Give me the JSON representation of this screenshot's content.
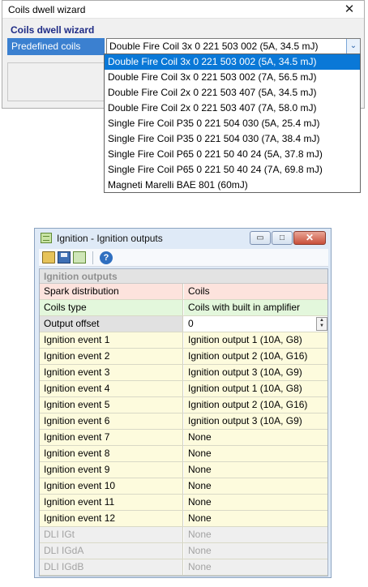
{
  "wizard": {
    "title": "Coils dwell wizard",
    "close_glyph": "✕",
    "section": "Coils dwell wizard",
    "field_label": "Predefined coils",
    "selected_value": "Double Fire Coil 3x 0 221 503 002  (5A, 34.5 mJ)",
    "dropdown_glyph": "⌄",
    "options": [
      "Double Fire Coil 3x 0 221 503 002  (5A, 34.5 mJ)",
      "Double Fire Coil 3x 0 221 503 002  (7A, 56.5 mJ)",
      "Double Fire Coil 2x 0 221 503 407  (5A, 34.5 mJ)",
      "Double Fire Coil 2x 0 221 503 407  (7A, 58.0 mJ)",
      "Single Fire Coil P35  0 221 504 030  (5A, 25.4 mJ)",
      "Single Fire Coil P35  0 221 504 030  (7A, 38.4 mJ)",
      "Single Fire Coil P65  0 221 50 40 24  (5A, 37.8 mJ)",
      "Single Fire Coil P65  0 221 50 40 24  (7A, 69.8 mJ)",
      "Magneti Marelli BAE 801 (60mJ)"
    ],
    "selected_index": 0
  },
  "ignition": {
    "title": "Ignition - Ignition outputs",
    "window_buttons": {
      "minimize": "▭",
      "maximize": "□",
      "close": "✕"
    },
    "toolbar": {
      "open_icon": "open-folder-icon",
      "save_icon": "save-disk-icon",
      "window_icon": "window-icon",
      "help_icon": "help-icon",
      "help_glyph": "?"
    },
    "section": "Ignition outputs",
    "rows": [
      {
        "label": "Spark distribution",
        "value": "Coils",
        "style": "pink"
      },
      {
        "label": "Coils type",
        "value": "Coils with built in amplifier",
        "style": "green"
      },
      {
        "label": "Output offset",
        "value": "0",
        "style": "gray"
      },
      {
        "label": "Ignition event 1",
        "value": "Ignition output 1 (10A, G8)",
        "style": "yellow"
      },
      {
        "label": "Ignition event 2",
        "value": "Ignition output 2 (10A, G16)",
        "style": "yellow"
      },
      {
        "label": "Ignition event 3",
        "value": "Ignition output 3 (10A, G9)",
        "style": "yellow"
      },
      {
        "label": "Ignition event 4",
        "value": "Ignition output 1 (10A, G8)",
        "style": "yellow"
      },
      {
        "label": "Ignition event 5",
        "value": "Ignition output 2 (10A, G16)",
        "style": "yellow"
      },
      {
        "label": "Ignition event 6",
        "value": "Ignition output 3 (10A, G9)",
        "style": "yellow"
      },
      {
        "label": "Ignition event 7",
        "value": "None",
        "style": "yellow"
      },
      {
        "label": "Ignition event 8",
        "value": "None",
        "style": "yellow"
      },
      {
        "label": "Ignition event 9",
        "value": "None",
        "style": "yellow"
      },
      {
        "label": "Ignition event 10",
        "value": "None",
        "style": "yellow"
      },
      {
        "label": "Ignition event 11",
        "value": "None",
        "style": "yellow"
      },
      {
        "label": "Ignition event 12",
        "value": "None",
        "style": "yellow"
      },
      {
        "label": "DLI IGt",
        "value": "None",
        "style": "dis"
      },
      {
        "label": "DLI IGdA",
        "value": "None",
        "style": "dis"
      },
      {
        "label": "DLI IGdB",
        "value": "None",
        "style": "dis"
      }
    ],
    "spin_up": "▲",
    "spin_down": "▼"
  },
  "colors": {
    "selection": "#0a78d7",
    "label_highlight": "#3b80d0",
    "section_text": "#1f2c86",
    "row_pink": "#fde3dd",
    "row_green": "#e3f7dc",
    "row_yellow": "#fdfbdd"
  }
}
